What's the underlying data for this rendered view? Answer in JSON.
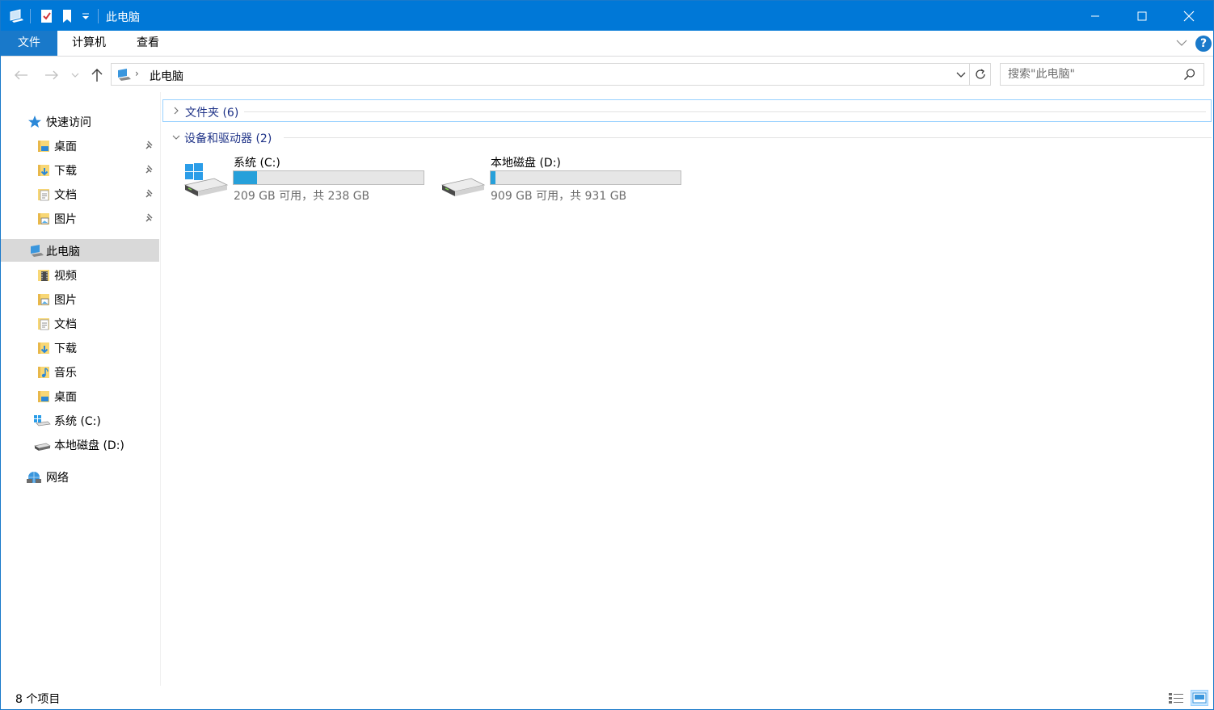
{
  "window": {
    "title": "此电脑",
    "quick_access_icons": [
      "this-pc-icon",
      "properties-icon",
      "new-folder-icon",
      "customize-dropdown-icon"
    ],
    "controls": [
      "minimize-icon",
      "maximize-icon",
      "close-icon"
    ]
  },
  "ribbon": {
    "tabs": [
      {
        "label": "文件",
        "active": true
      },
      {
        "label": "计算机"
      },
      {
        "label": "查看"
      }
    ],
    "help_label": "?"
  },
  "navigation": {
    "address_separator": "›",
    "address_path": "此电脑",
    "search_placeholder": "搜索\"此电脑\""
  },
  "sidebar": {
    "quick_access": {
      "label": "快速访问",
      "icon": "star-icon"
    },
    "quick_items": [
      {
        "label": "桌面",
        "icon": "desktop-folder-icon",
        "pinned": true
      },
      {
        "label": "下载",
        "icon": "downloads-folder-icon",
        "pinned": true
      },
      {
        "label": "文档",
        "icon": "documents-folder-icon",
        "pinned": true
      },
      {
        "label": "图片",
        "icon": "pictures-folder-icon",
        "pinned": true
      }
    ],
    "this_pc": {
      "label": "此电脑",
      "icon": "this-pc-icon",
      "selected": true
    },
    "pc_items": [
      {
        "label": "视频",
        "icon": "videos-folder-icon"
      },
      {
        "label": "图片",
        "icon": "pictures-folder-icon"
      },
      {
        "label": "文档",
        "icon": "documents-folder-icon"
      },
      {
        "label": "下载",
        "icon": "downloads-folder-icon"
      },
      {
        "label": "音乐",
        "icon": "music-folder-icon"
      },
      {
        "label": "桌面",
        "icon": "desktop-folder-icon"
      },
      {
        "label": "系统 (C:)",
        "icon": "system-drive-icon"
      },
      {
        "label": "本地磁盘 (D:)",
        "icon": "local-disk-icon"
      }
    ],
    "network": {
      "label": "网络",
      "icon": "network-icon"
    }
  },
  "content": {
    "groups": [
      {
        "label": "文件夹 (6)",
        "expanded": false
      },
      {
        "label": "设备和驱动器 (2)",
        "expanded": true
      }
    ],
    "drives": [
      {
        "name": "系统 (C:)",
        "info": "209 GB 可用，共 238 GB",
        "free_gb": 209,
        "total_gb": 238,
        "icon": "windows-drive-icon"
      },
      {
        "name": "本地磁盘 (D:)",
        "info": "909 GB 可用，共 931 GB",
        "free_gb": 909,
        "total_gb": 931,
        "icon": "hard-drive-icon"
      }
    ]
  },
  "status": {
    "item_count": "8 个项目"
  },
  "colors": {
    "title_bar": "#0078d7",
    "file_tab": "#1979ca",
    "drive_bar_fill": "#26a0da",
    "group_header_text": "#1e3287",
    "selected_row": "#d9d9d9"
  }
}
